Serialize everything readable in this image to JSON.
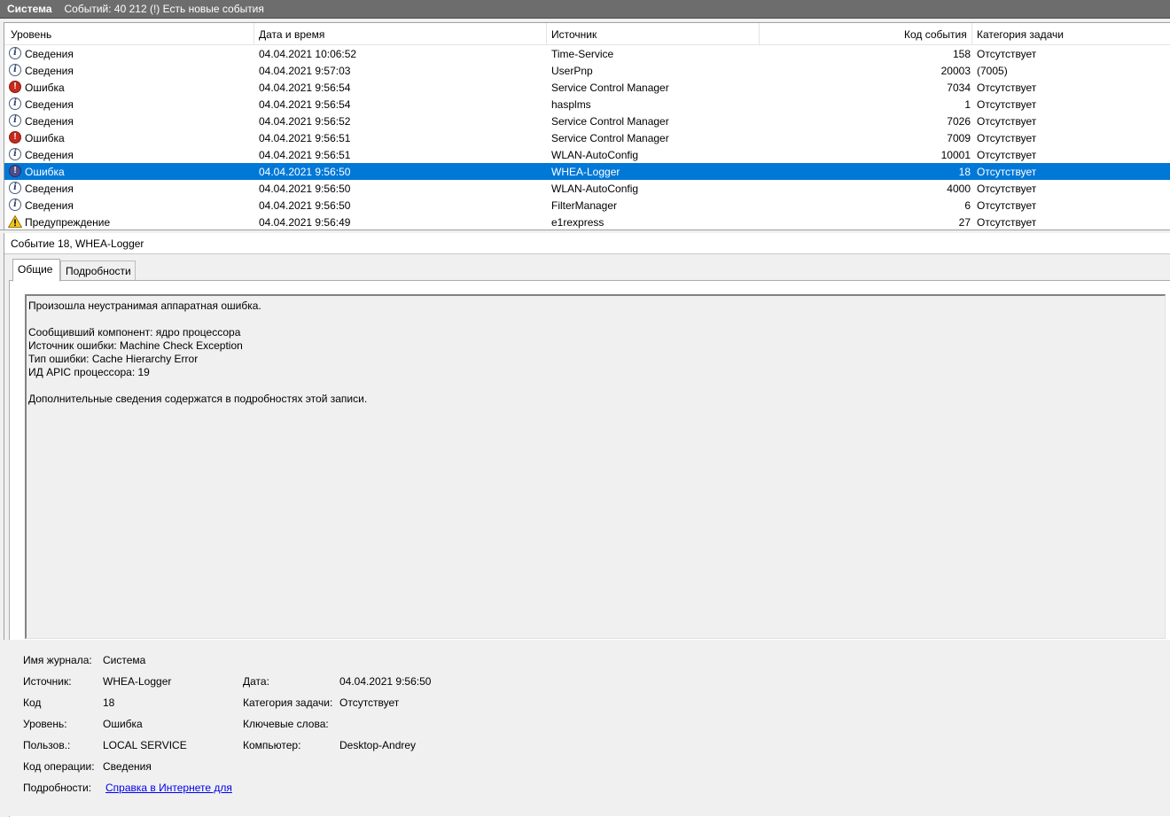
{
  "title": {
    "log": "Система",
    "info": "Событий: 40 212 (!) Есть новые события"
  },
  "columns": {
    "level": "Уровень",
    "date": "Дата и время",
    "source": "Источник",
    "code": "Код события",
    "category": "Категория задачи"
  },
  "rows": [
    {
      "icon": "info-icon",
      "level": "Сведения",
      "date": "04.04.2021 10:06:52",
      "source": "Time-Service",
      "code": "158",
      "category": "Отсутствует"
    },
    {
      "icon": "info-icon",
      "level": "Сведения",
      "date": "04.04.2021 9:57:03",
      "source": "UserPnp",
      "code": "20003",
      "category": "(7005)"
    },
    {
      "icon": "error-icon",
      "level": "Ошибка",
      "date": "04.04.2021 9:56:54",
      "source": "Service Control Manager",
      "code": "7034",
      "category": "Отсутствует"
    },
    {
      "icon": "info-icon",
      "level": "Сведения",
      "date": "04.04.2021 9:56:54",
      "source": "hasplms",
      "code": "1",
      "category": "Отсутствует"
    },
    {
      "icon": "info-icon",
      "level": "Сведения",
      "date": "04.04.2021 9:56:52",
      "source": "Service Control Manager",
      "code": "7026",
      "category": "Отсутствует"
    },
    {
      "icon": "error-icon",
      "level": "Ошибка",
      "date": "04.04.2021 9:56:51",
      "source": "Service Control Manager",
      "code": "7009",
      "category": "Отсутствует"
    },
    {
      "icon": "info-icon",
      "level": "Сведения",
      "date": "04.04.2021 9:56:51",
      "source": "WLAN-AutoConfig",
      "code": "10001",
      "category": "Отсутствует"
    },
    {
      "icon": "error-icon",
      "level": "Ошибка",
      "date": "04.04.2021 9:56:50",
      "source": "WHEA-Logger",
      "code": "18",
      "category": "Отсутствует",
      "selected": true
    },
    {
      "icon": "info-icon",
      "level": "Сведения",
      "date": "04.04.2021 9:56:50",
      "source": "WLAN-AutoConfig",
      "code": "4000",
      "category": "Отсутствует"
    },
    {
      "icon": "info-icon",
      "level": "Сведения",
      "date": "04.04.2021 9:56:50",
      "source": "FilterManager",
      "code": "6",
      "category": "Отсутствует"
    },
    {
      "icon": "warning-icon",
      "level": "Предупреждение",
      "date": "04.04.2021 9:56:49",
      "source": "e1rexpress",
      "code": "27",
      "category": "Отсутствует"
    }
  ],
  "detail": {
    "title": "Событие 18, WHEA-Logger",
    "tabs": {
      "general": "Общие",
      "details": "Подробности"
    },
    "message": [
      "Произошла неустранимая аппаратная ошибка.",
      "",
      "Сообщивший компонент: ядро процессора",
      "Источник ошибки: Machine Check Exception",
      "Тип ошибки: Cache Hierarchy Error",
      "ИД APIC процессора: 19",
      "",
      "Дополнительные сведения содержатся в подробностях этой записи."
    ],
    "props": {
      "log_label": "Имя журнала:",
      "log_value": "Система",
      "source_label": "Источник:",
      "source_value": "WHEA-Logger",
      "date_label": "Дата:",
      "date_value": "04.04.2021 9:56:50",
      "code_label": "Код",
      "code_value": "18",
      "category_label": "Категория задачи:",
      "category_value": "Отсутствует",
      "level_label": "Уровень:",
      "level_value": "Ошибка",
      "keywords_label": "Ключевые слова:",
      "user_label": "Пользов.:",
      "user_value": "LOCAL SERVICE",
      "computer_label": "Компьютер:",
      "computer_value": "Desktop-Andrey",
      "opcode_label": "Код операции:",
      "opcode_value": "Сведения",
      "more_label": "Подробности:",
      "more_link": "Справка в Интернете для"
    }
  }
}
